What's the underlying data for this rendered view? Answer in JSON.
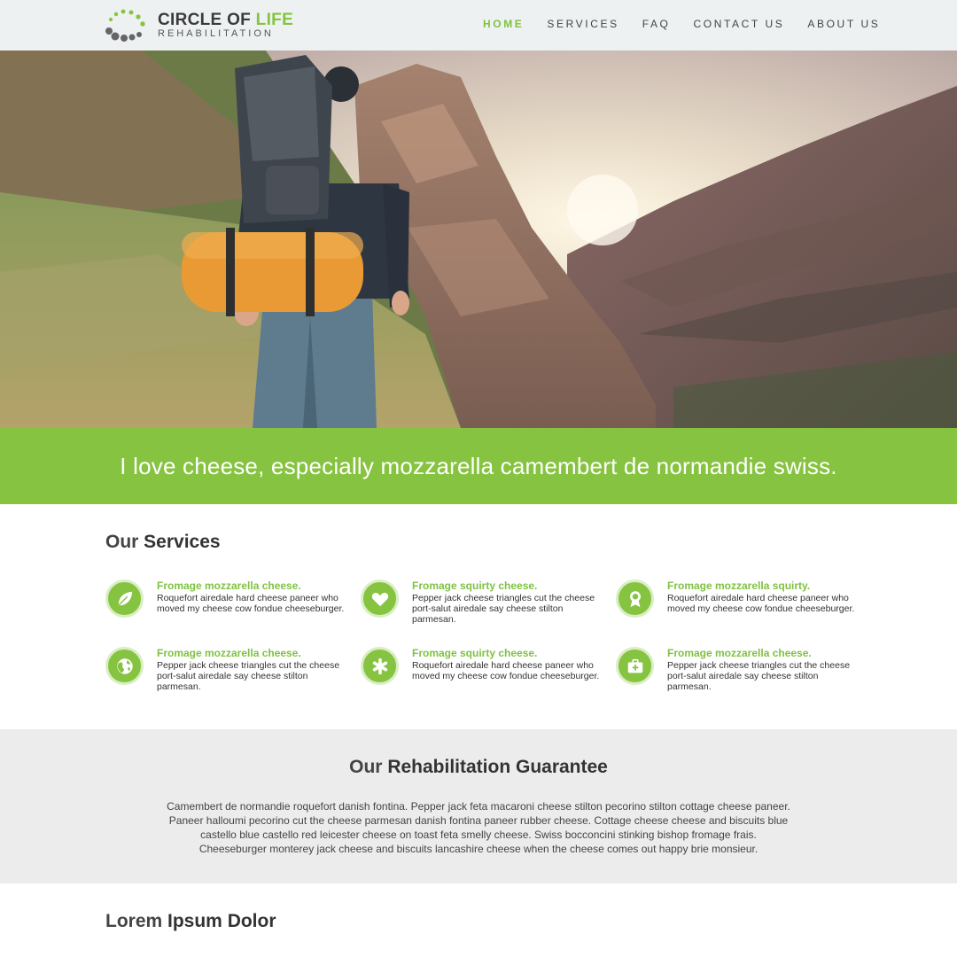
{
  "brand": {
    "name_main": "CIRCLE OF ",
    "name_accent": "LIFE",
    "tagline": "REHABILITATION"
  },
  "nav": {
    "items": [
      {
        "label": "HOME",
        "active": true
      },
      {
        "label": "SERVICES",
        "active": false
      },
      {
        "label": "FAQ",
        "active": false
      },
      {
        "label": "CONTACT US",
        "active": false
      },
      {
        "label": "ABOUT US",
        "active": false
      }
    ]
  },
  "banner": {
    "text": "I love cheese, especially mozzarella camembert de normandie swiss."
  },
  "services": {
    "heading_light": "Our ",
    "heading_bold": "Services",
    "items": [
      {
        "icon": "leaf-icon",
        "title": "Fromage mozzarella cheese.",
        "text": "Roquefort airedale hard cheese paneer who moved my cheese cow fondue cheeseburger."
      },
      {
        "icon": "heart-icon",
        "title": "Fromage squirty cheese.",
        "text": "Pepper jack cheese triangles cut the cheese port-salut airedale say cheese stilton parmesan."
      },
      {
        "icon": "award-icon",
        "title": "Fromage mozzarella squirty.",
        "text": "Roquefort airedale hard cheese paneer who moved my cheese cow fondue cheeseburger."
      },
      {
        "icon": "globe-icon",
        "title": "Fromage mozzarella cheese.",
        "text": "Pepper jack cheese triangles cut the cheese port-salut airedale say cheese stilton parmesan."
      },
      {
        "icon": "asterisk-icon",
        "title": "Fromage squirty cheese.",
        "text": "Roquefort airedale hard cheese paneer who moved my cheese cow fondue cheeseburger."
      },
      {
        "icon": "first-aid-icon",
        "title": "Fromage mozzarella cheese.",
        "text": "Pepper jack cheese triangles cut the cheese port-salut airedale say cheese stilton parmesan."
      }
    ]
  },
  "guarantee": {
    "heading_light": "Our ",
    "heading_bold": "Rehabilitation Guarantee",
    "text": "Camembert de normandie roquefort danish fontina. Pepper jack feta macaroni cheese stilton pecorino stilton cottage cheese paneer. Paneer halloumi pecorino cut the cheese parmesan danish fontina paneer rubber cheese. Cottage cheese cheese and biscuits blue castello blue castello red leicester cheese on toast feta smelly cheese. Swiss bocconcini stinking bishop fromage frais. Cheeseburger monterey jack cheese and biscuits lancashire cheese when the cheese comes out happy brie monsieur."
  },
  "lorem": {
    "heading_light": "Lorem ",
    "heading_bold": "Ipsum Dolor"
  },
  "colors": {
    "accent": "#86c340",
    "nav_bg": "#eef1f1",
    "guarantee_bg": "#ececec"
  }
}
